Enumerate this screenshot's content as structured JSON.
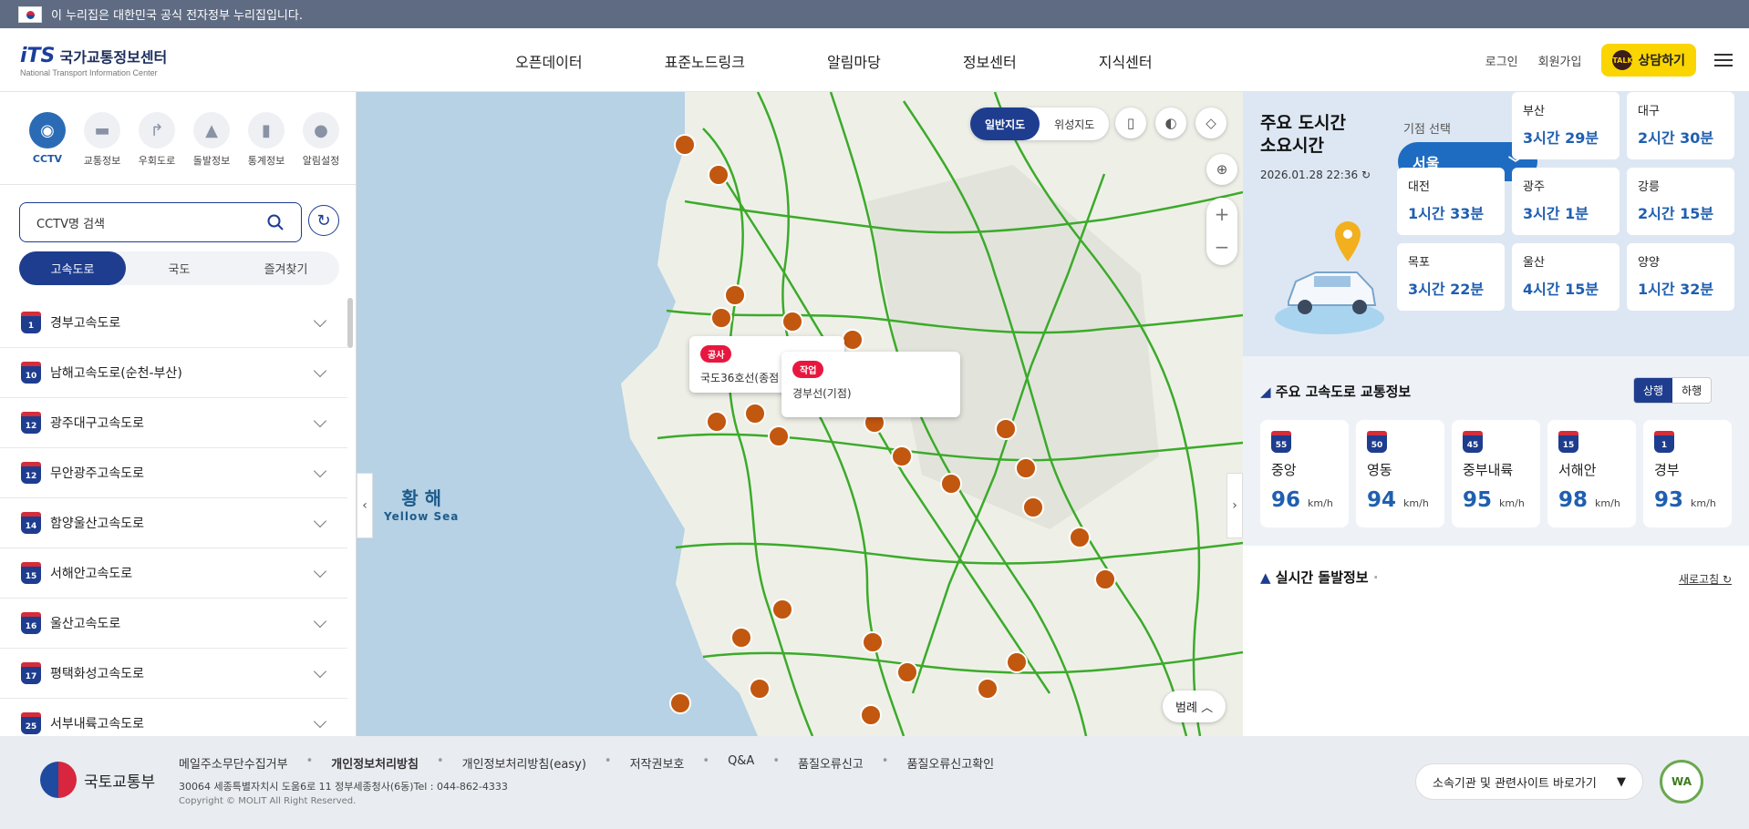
{
  "gov_bar": {
    "text": "이 누리집은 대한민국 공식 전자정부 누리집입니다."
  },
  "header": {
    "logo_mark": "iTS",
    "logo_kor": "국가교통정보센터",
    "logo_eng": "National Transport Information Center",
    "nav": [
      "오픈데이터",
      "표준노드링크",
      "알림마당",
      "정보센터",
      "지식센터"
    ],
    "login": "로그인",
    "signup": "회원가입",
    "talk_badge": "TALK",
    "talk": "상담하기"
  },
  "left": {
    "categories": [
      {
        "label": "CCTV",
        "icon": "cctv-icon"
      },
      {
        "label": "교통정보",
        "icon": "car-icon"
      },
      {
        "label": "우회도로",
        "icon": "detour-icon"
      },
      {
        "label": "돌발정보",
        "icon": "incident-icon"
      },
      {
        "label": "통계정보",
        "icon": "stats-icon"
      },
      {
        "label": "알림설정",
        "icon": "pin-icon"
      }
    ],
    "search_placeholder": "CCTV명 검색",
    "tabs": [
      "고속도로",
      "국도",
      "즐겨찾기"
    ],
    "roads": [
      {
        "no": "1",
        "name": "경부고속도로"
      },
      {
        "no": "10",
        "name": "남해고속도로(순천-부산)"
      },
      {
        "no": "12",
        "name": "광주대구고속도로"
      },
      {
        "no": "12",
        "name": "무안광주고속도로"
      },
      {
        "no": "14",
        "name": "함양울산고속도로"
      },
      {
        "no": "15",
        "name": "서해안고속도로"
      },
      {
        "no": "16",
        "name": "울산고속도로"
      },
      {
        "no": "17",
        "name": "평택화성고속도로"
      },
      {
        "no": "25",
        "name": "서부내륙고속도로"
      }
    ]
  },
  "map": {
    "toggle": [
      "일반지도",
      "위성지도"
    ],
    "popup1": {
      "tag": "공사",
      "text": "국도36호선(종점"
    },
    "popup2": {
      "tag": "작업",
      "text": "경부선(기점)"
    },
    "sea_kor": "황 해",
    "sea_eng": "Yellow Sea",
    "legend": "범례",
    "zoom_in": "+",
    "zoom_out": "−"
  },
  "right": {
    "title_line1": "주요 도시간",
    "title_line2": "소요시간",
    "date": "2026.01.28 22:36",
    "select_label": "기점 선택",
    "select_value": "서울",
    "cities": [
      {
        "city": "부산",
        "time": "3시간 29분"
      },
      {
        "city": "대구",
        "time": "2시간 30분"
      },
      {
        "city": "대전",
        "time": "1시간 33분"
      },
      {
        "city": "광주",
        "time": "3시간 1분"
      },
      {
        "city": "강릉",
        "time": "2시간 15분"
      },
      {
        "city": "목포",
        "time": "3시간 22분"
      },
      {
        "city": "울산",
        "time": "4시간 15분"
      },
      {
        "city": "양양",
        "time": "1시간 32분"
      }
    ],
    "hw_title": "주요 고속도로 교통정보",
    "up": "상행",
    "down": "하행",
    "speeds": [
      {
        "no": "55",
        "name": "중앙",
        "speed": "96",
        "unit": "km/h"
      },
      {
        "no": "50",
        "name": "영동",
        "speed": "94",
        "unit": "km/h"
      },
      {
        "no": "45",
        "name": "중부내륙",
        "speed": "95",
        "unit": "km/h"
      },
      {
        "no": "15",
        "name": "서해안",
        "speed": "98",
        "unit": "km/h"
      },
      {
        "no": "1",
        "name": "경부",
        "speed": "93",
        "unit": "km/h"
      }
    ],
    "incident_title": "실시간 돌발정보",
    "refresh": "새로고침"
  },
  "footer": {
    "ministry": "국토교통부",
    "links": [
      "메일주소무단수집거부",
      "개인정보처리방침",
      "개인정보처리방침(easy)",
      "저작권보호",
      "Q&A",
      "품질오류신고",
      "품질오류신고확인"
    ],
    "address": "30064 세종특별자치시 도움6로 11 정부세종청사(6동)Tel : 044-862-4333",
    "copyright": "Copyright © MOLIT All Right Reserved.",
    "related": "소속기관 및 관련사이트 바로가기",
    "wa": "WA"
  },
  "colors": {
    "primary": "#1e3d8f",
    "accent": "#1e6cc2",
    "road": "#3caa2a",
    "incident": "#c2570f"
  }
}
